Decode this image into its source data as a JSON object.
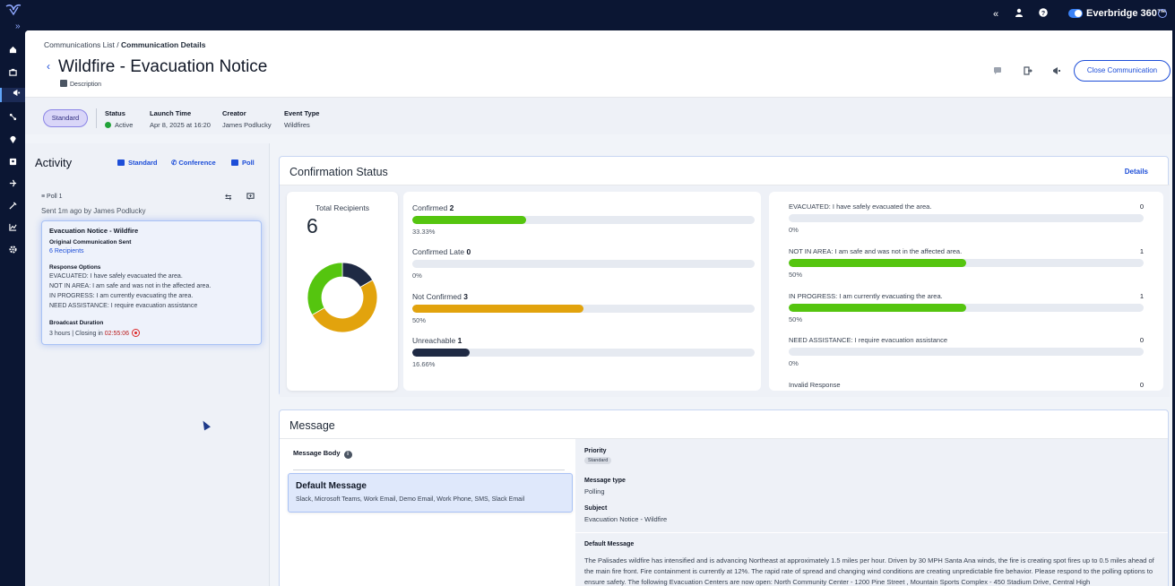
{
  "topbar": {
    "brand": "Everbridge 360™",
    "icons": [
      "collapse-icon",
      "user-icon",
      "help-icon",
      "toggle",
      "settings-icon"
    ]
  },
  "nav": {
    "icons": [
      "home-icon",
      "incidents-icon",
      "communications-icon",
      "integrations-icon",
      "location-icon",
      "contacts-icon",
      "travel-icon",
      "tools-icon",
      "analytics-icon",
      "settings-icon"
    ],
    "active": "communications-icon"
  },
  "header": {
    "breadcrumb_list": "Communications List",
    "breadcrumb_sep": " / ",
    "breadcrumb_current": "Communication Details",
    "title": "Wildfire - Evacuation Notice",
    "description": "Description",
    "close_button": "Close Communication"
  },
  "info": {
    "type_pill": "Standard",
    "status_label": "Status",
    "status_value": "Active",
    "launch_label": "Launch Time",
    "launch_value": "Apr 8, 2025 at 16:20",
    "creator_label": "Creator",
    "creator_value": "James Podlucky",
    "event_label": "Event Type",
    "event_value": "Wildfires"
  },
  "activity": {
    "title": "Activity",
    "tab_standard": "Standard",
    "tab_conference": "Conference",
    "tab_poll": "Poll",
    "poll_label": "Poll 1",
    "sent": "Sent 1m ago by James Podlucky",
    "card": {
      "title": "Evacuation Notice - Wildfire",
      "orig_label": "Original Communication Sent",
      "recipients": "6 Recipients",
      "response_label": "Response Options",
      "options": [
        "EVACUATED: I have safely evacuated the area.",
        "NOT IN AREA: I am safe and was not in the affected area.",
        "IN PROGRESS: I am currently evacuating the area.",
        "NEED ASSISTANCE: I require evacuation assistance"
      ],
      "duration_label": "Broadcast Duration",
      "duration_prefix": "3 hours | Closing in ",
      "duration_timer": "02:55:06"
    }
  },
  "confirmation": {
    "title": "Confirmation Status",
    "details": "Details",
    "total_label": "Total Recipients",
    "total": "6",
    "stats": [
      {
        "label": "Confirmed",
        "count": "2",
        "pct": "33.33%",
        "fraction": 0.3333,
        "color": "#55c50f"
      },
      {
        "label": "Confirmed Late",
        "count": "0",
        "pct": "0%",
        "fraction": 0,
        "color": "#55c50f"
      },
      {
        "label": "Not Confirmed",
        "count": "3",
        "pct": "50%",
        "fraction": 0.5,
        "color": "#e2a30d"
      },
      {
        "label": "Unreachable",
        "count": "1",
        "pct": "16.66%",
        "fraction": 0.1666,
        "color": "#1f2a44"
      }
    ],
    "responses": [
      {
        "label": "EVACUATED: I have safely evacuated the area.",
        "count": "0",
        "pct": "0%",
        "fraction": 0
      },
      {
        "label": "NOT IN AREA: I am safe and was not in the affected area.",
        "count": "1",
        "pct": "50%",
        "fraction": 0.5
      },
      {
        "label": "IN PROGRESS: I am currently evacuating the area.",
        "count": "1",
        "pct": "50%",
        "fraction": 0.5
      },
      {
        "label": "NEED ASSISTANCE: I require evacuation assistance",
        "count": "0",
        "pct": "0%",
        "fraction": 0
      },
      {
        "label": "Invalid Response",
        "count": "0"
      }
    ],
    "response_color": "#55c50f"
  },
  "chart_data": {
    "type": "pie",
    "categories": [
      "Confirmed",
      "Confirmed Late",
      "Not Confirmed",
      "Unreachable"
    ],
    "values": [
      2,
      0,
      3,
      1
    ],
    "colors": [
      "#55c50f",
      "#55c50f",
      "#e2a30d",
      "#1f2a44"
    ],
    "title": ""
  },
  "message": {
    "title": "Message",
    "body_label": "Message Body",
    "default_title": "Default Message",
    "channels": "Slack, Microsoft Teams, Work Email, Demo Email, Work Phone, SMS, Slack Email",
    "priority_label": "Priority",
    "priority_value": "Standard",
    "type_label": "Message type",
    "type_value": "Polling",
    "subject_label": "Subject",
    "subject_value": "Evacuation Notice - Wildfire",
    "default_label": "Default Message",
    "body_text": "The Palisades wildfire has intensified and is advancing Northeast at approximately 1.5 miles per hour. Driven by 30 MPH Santa Ana winds, the fire is creating spot fires up to 0.5 miles ahead of the main fire front. Fire containment is currently at 12%. The rapid rate of spread and changing wind conditions are creating unpredictable fire behavior. Please respond to the polling options to ensure safety. The following Evacuation Centers are now open: North Community Center - 1200 Pine Street , Mountain Sports Complex - 450 Stadium Drive, Central High"
  }
}
